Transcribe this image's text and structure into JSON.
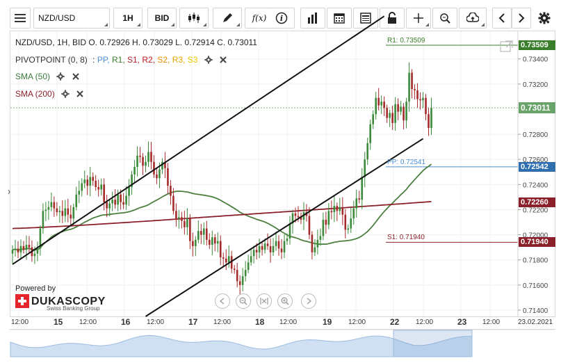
{
  "toolbar": {
    "menu_icon": "hamburger-icon",
    "symbol": "NZD/USD",
    "timeframe": "1H",
    "price_side": "BID",
    "tools": [
      "candles-icon",
      "pencil-icon",
      "function-icon",
      "info-icon",
      "bar-chart-icon",
      "calendar-icon",
      "document-icon",
      "lock-icon",
      "crosshair-icon",
      "zoom-icon",
      "cloud-upload-icon",
      "arrow-left-icon",
      "arrow-right-icon",
      "gear-icon"
    ],
    "fx_label": "f(x)"
  },
  "legend": {
    "ohlc": "NZD/USD, 1H, BID   O. 0.72926 H. 0.73029 L. 0.72914 C. 0.73011",
    "pivot_name": "PIVOTPOINT (0, 8)",
    "pivot_sep": ":",
    "pivot_items": [
      {
        "label": "PP,",
        "color": "#4a90d9"
      },
      {
        "label": "R1,",
        "color": "#3a7d2a"
      },
      {
        "label": "S1,",
        "color": "#b0222a"
      },
      {
        "label": "R2,",
        "color": "#c41a1a"
      },
      {
        "label": "S2,",
        "color": "#f08c00"
      },
      {
        "label": "R3,",
        "color": "#e8a800"
      },
      {
        "label": "S3",
        "color": "#e8c800"
      }
    ],
    "sma50": "SMA (50)",
    "sma200": "SMA (200)"
  },
  "branding": {
    "powered_by": "Powered by",
    "name": "DUKASCOPY",
    "tagline": "Swiss Banking Group"
  },
  "navigation_icons": [
    "play-back-icon",
    "zoom-out-icon",
    "fit-icon",
    "zoom-in-icon",
    "play-forward-icon"
  ],
  "colors": {
    "bull": "#3a8a3a",
    "bear": "#a52a2a",
    "sma50": "#4b7f3e",
    "sma200": "#8b1f2a",
    "channel": "#111111",
    "r1": "#3a7d2a",
    "pp": "#4a90d9",
    "s1": "#8b1f2a",
    "current": "#6aa36a"
  },
  "chart_data": {
    "type": "candlestick",
    "symbol": "NZD/USD",
    "timeframe": "1H",
    "price_side": "BID",
    "last_bar": {
      "open": 0.72926,
      "high": 0.73029,
      "low": 0.72914,
      "close": 0.73011
    },
    "y_ticks": [
      "0.73400",
      "0.73200",
      "0.72800",
      "0.72600",
      "0.72400",
      "0.72200",
      "0.72000",
      "0.71800",
      "0.71600",
      "0.71400"
    ],
    "ylim": [
      0.7135,
      0.7362
    ],
    "x_ticks": [
      {
        "label": "12:00",
        "day": false
      },
      {
        "label": "15",
        "day": true
      },
      {
        "label": "12:00",
        "day": false
      },
      {
        "label": "16",
        "day": true
      },
      {
        "label": "12:00",
        "day": false
      },
      {
        "label": "17",
        "day": true
      },
      {
        "label": "12:00",
        "day": false
      },
      {
        "label": "18",
        "day": true
      },
      {
        "label": "12:00",
        "day": false
      },
      {
        "label": "19",
        "day": true
      },
      {
        "label": "12:00",
        "day": false
      },
      {
        "label": "22",
        "day": true
      },
      {
        "label": "12:00",
        "day": false
      },
      {
        "label": "23",
        "day": true
      },
      {
        "label": "12:00",
        "day": false
      },
      {
        "label": "23.02.2021",
        "day": false
      }
    ],
    "levels": {
      "r1": {
        "label": "R1: 0.73509",
        "tag": "0.73509",
        "value": 0.73509
      },
      "current": {
        "tag": "0.73011",
        "value": 0.73011
      },
      "pp": {
        "label": "PP: 0.72541",
        "tag": "0.72542",
        "value": 0.72541
      },
      "sma200": {
        "tag": "0.72260",
        "value": 0.7226
      },
      "s1": {
        "label": "S1: 0.71940",
        "tag": "0.71940",
        "value": 0.7194
      }
    },
    "channel_lines": [
      {
        "name": "upper",
        "from": {
          "i": 0,
          "price": 0.71765
        },
        "to": {
          "i": 134,
          "price": 0.7374
        }
      },
      {
        "name": "lower",
        "from": {
          "i": 48,
          "price": 0.7135
        },
        "to": {
          "i": 148,
          "price": 0.72765
        }
      }
    ],
    "closes": [
      0.7188,
      0.7189,
      0.7186,
      0.7191,
      0.7188,
      0.7192,
      0.719,
      0.7183,
      0.7185,
      0.7189,
      0.7205,
      0.7219,
      0.722,
      0.7222,
      0.7226,
      0.7221,
      0.7218,
      0.7219,
      0.7215,
      0.7221,
      0.7216,
      0.7213,
      0.7222,
      0.7232,
      0.7235,
      0.7241,
      0.7244,
      0.7239,
      0.7246,
      0.7243,
      0.7238,
      0.7236,
      0.724,
      0.7226,
      0.7221,
      0.7225,
      0.7228,
      0.7224,
      0.7232,
      0.7226,
      0.7224,
      0.7231,
      0.7238,
      0.7248,
      0.7254,
      0.7263,
      0.7262,
      0.7255,
      0.7258,
      0.7266,
      0.7258,
      0.7248,
      0.7245,
      0.7252,
      0.7258,
      0.7253,
      0.7239,
      0.7231,
      0.7219,
      0.7213,
      0.7214,
      0.7211,
      0.7206,
      0.7213,
      0.7195,
      0.7191,
      0.7196,
      0.7203,
      0.72,
      0.7205,
      0.7196,
      0.7192,
      0.7198,
      0.7193,
      0.7195,
      0.7182,
      0.7181,
      0.7178,
      0.7183,
      0.7173,
      0.7172,
      0.7163,
      0.716,
      0.7167,
      0.7172,
      0.7178,
      0.7183,
      0.7188,
      0.7186,
      0.7191,
      0.7188,
      0.7193,
      0.7191,
      0.7186,
      0.7191,
      0.7195,
      0.7189,
      0.7186,
      0.7195,
      0.7197,
      0.7209,
      0.7217,
      0.7215,
      0.7214,
      0.7212,
      0.7218,
      0.7215,
      0.72,
      0.7186,
      0.719,
      0.7196,
      0.7199,
      0.7212,
      0.7208,
      0.7219,
      0.7218,
      0.7223,
      0.7219,
      0.7222,
      0.7216,
      0.7204,
      0.7205,
      0.7213,
      0.7221,
      0.7229,
      0.7228,
      0.7246,
      0.726,
      0.7273,
      0.7288,
      0.7296,
      0.7309,
      0.7303,
      0.7306,
      0.7301,
      0.7293,
      0.7297,
      0.7289,
      0.7304,
      0.7298,
      0.7302,
      0.7291,
      0.7306,
      0.7329,
      0.7316,
      0.7315,
      0.7308,
      0.7307,
      0.7309,
      0.7296,
      0.7285,
      0.7301
    ]
  }
}
